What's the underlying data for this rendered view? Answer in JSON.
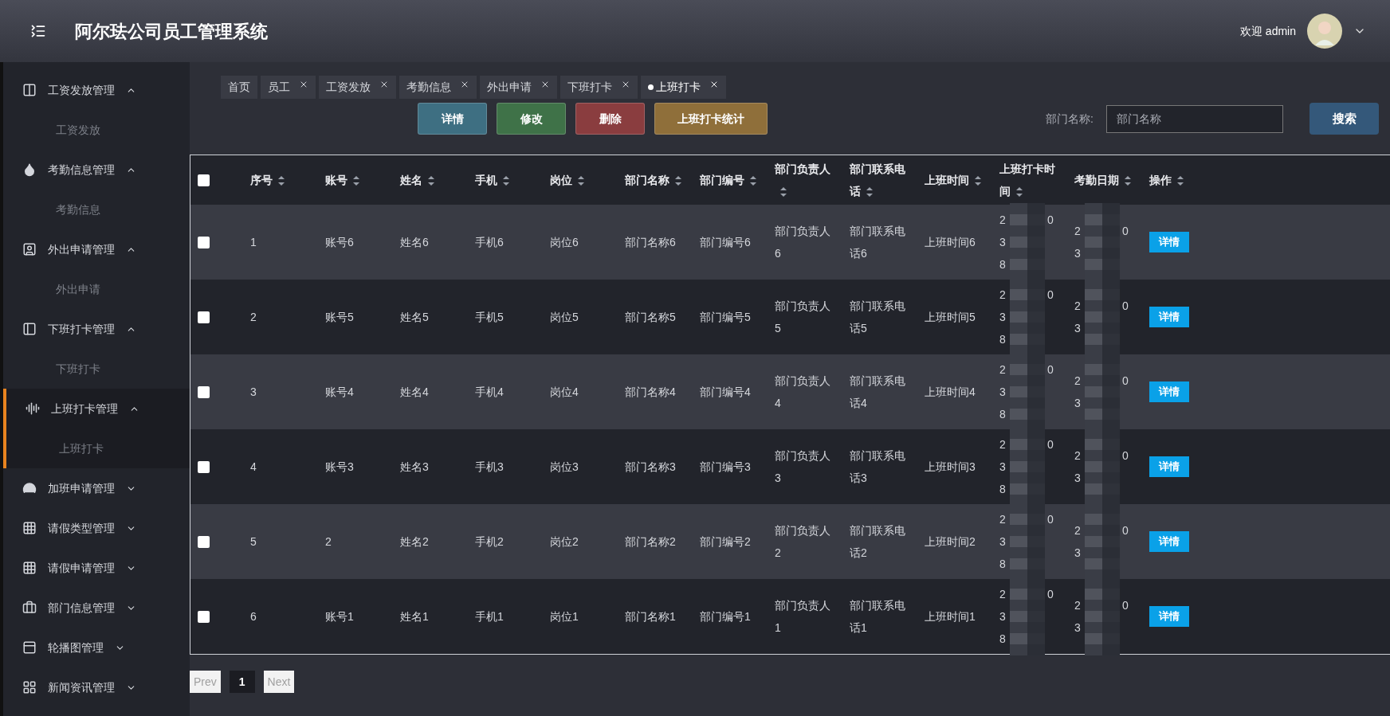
{
  "header": {
    "title": "阿尔珐公司员工管理系统",
    "welcome": "欢迎 admin"
  },
  "sidebar": {
    "items": [
      {
        "label": "工资发放管理",
        "expanded": true,
        "selected": false,
        "children": [
          {
            "label": "工资发放"
          }
        ]
      },
      {
        "label": "考勤信息管理",
        "expanded": true,
        "selected": false,
        "children": [
          {
            "label": "考勤信息"
          }
        ]
      },
      {
        "label": "外出申请管理",
        "expanded": true,
        "selected": false,
        "children": [
          {
            "label": "外出申请"
          }
        ]
      },
      {
        "label": "下班打卡管理",
        "expanded": true,
        "selected": false,
        "children": [
          {
            "label": "下班打卡"
          }
        ]
      },
      {
        "label": "上班打卡管理",
        "expanded": true,
        "selected": true,
        "children": [
          {
            "label": "上班打卡"
          }
        ]
      },
      {
        "label": "加班申请管理",
        "expanded": false,
        "selected": false
      },
      {
        "label": "请假类型管理",
        "expanded": false,
        "selected": false
      },
      {
        "label": "请假申请管理",
        "expanded": false,
        "selected": false
      },
      {
        "label": "部门信息管理",
        "expanded": false,
        "selected": false
      },
      {
        "label": "轮播图管理",
        "expanded": false,
        "selected": false
      },
      {
        "label": "新闻资讯管理",
        "expanded": false,
        "selected": false
      }
    ]
  },
  "tabs": [
    {
      "label": "首页",
      "closable": false,
      "selected": false
    },
    {
      "label": "员工",
      "closable": true,
      "selected": false
    },
    {
      "label": "工资发放",
      "closable": true,
      "selected": false
    },
    {
      "label": "考勤信息",
      "closable": true,
      "selected": false
    },
    {
      "label": "外出申请",
      "closable": true,
      "selected": false
    },
    {
      "label": "下班打卡",
      "closable": true,
      "selected": false
    },
    {
      "label": "上班打卡",
      "closable": true,
      "selected": true
    }
  ],
  "actions": [
    {
      "label": "详情",
      "color": "#3e6f82"
    },
    {
      "label": "修改",
      "color": "#3f7248"
    },
    {
      "label": "删除",
      "color": "#8a3d3f"
    },
    {
      "label": "上班打卡统计",
      "color": "#8f6f3a"
    }
  ],
  "search": {
    "label": "部门名称:",
    "placeholder": "部门名称",
    "button": "搜索"
  },
  "table": {
    "all_checked": false,
    "columns": [
      "序号",
      "账号",
      "姓名",
      "手机",
      "岗位",
      "部门名称",
      "部门编号",
      "部门负责人",
      "部门联系电话",
      "上班时间",
      "上班打卡时间",
      "考勤日期",
      "操作"
    ],
    "rows": [
      {
        "checked": false,
        "cells": [
          "1",
          "账号6",
          "姓名6",
          "手机6",
          "岗位6",
          "部门名称6",
          "部门编号6",
          "部门负责人6",
          "部门联系电话6",
          "上班时间6"
        ],
        "punch": [
          "2 0",
          "3",
          "8"
        ],
        "date": [
          "2 0",
          "3"
        ],
        "action": "详情"
      },
      {
        "checked": false,
        "cells": [
          "2",
          "账号5",
          "姓名5",
          "手机5",
          "岗位5",
          "部门名称5",
          "部门编号5",
          "部门负责人5",
          "部门联系电话5",
          "上班时间5"
        ],
        "punch": [
          "2 0",
          "3",
          "8"
        ],
        "date": [
          "2 0",
          "3"
        ],
        "action": "详情"
      },
      {
        "checked": false,
        "cells": [
          "3",
          "账号4",
          "姓名4",
          "手机4",
          "岗位4",
          "部门名称4",
          "部门编号4",
          "部门负责人4",
          "部门联系电话4",
          "上班时间4"
        ],
        "punch": [
          "2 0",
          "3",
          "8"
        ],
        "date": [
          "2 0",
          "3"
        ],
        "action": "详情"
      },
      {
        "checked": false,
        "cells": [
          "4",
          "账号3",
          "姓名3",
          "手机3",
          "岗位3",
          "部门名称3",
          "部门编号3",
          "部门负责人3",
          "部门联系电话3",
          "上班时间3"
        ],
        "punch": [
          "2 0",
          "3",
          "8"
        ],
        "date": [
          "2 0",
          "3"
        ],
        "action": "详情"
      },
      {
        "checked": false,
        "cells": [
          "5",
          "2",
          "姓名2",
          "手机2",
          "岗位2",
          "部门名称2",
          "部门编号2",
          "部门负责人2",
          "部门联系电话2",
          "上班时间2"
        ],
        "punch": [
          "2 0",
          "3",
          "8"
        ],
        "date": [
          "2 0",
          "3"
        ],
        "action": "详情"
      },
      {
        "checked": false,
        "cells": [
          "6",
          "账号1",
          "姓名1",
          "手机1",
          "岗位1",
          "部门名称1",
          "部门编号1",
          "部门负责人1",
          "部门联系电话1",
          "上班时间1"
        ],
        "punch": [
          "2 0",
          "3",
          "8"
        ],
        "date": [
          "2 0",
          "3"
        ],
        "action": "详情"
      }
    ]
  },
  "pagination": [
    {
      "label": "Prev",
      "kind": "nav"
    },
    {
      "label": "1",
      "kind": "page",
      "selected": true
    },
    {
      "label": "Next",
      "kind": "nav"
    }
  ]
}
